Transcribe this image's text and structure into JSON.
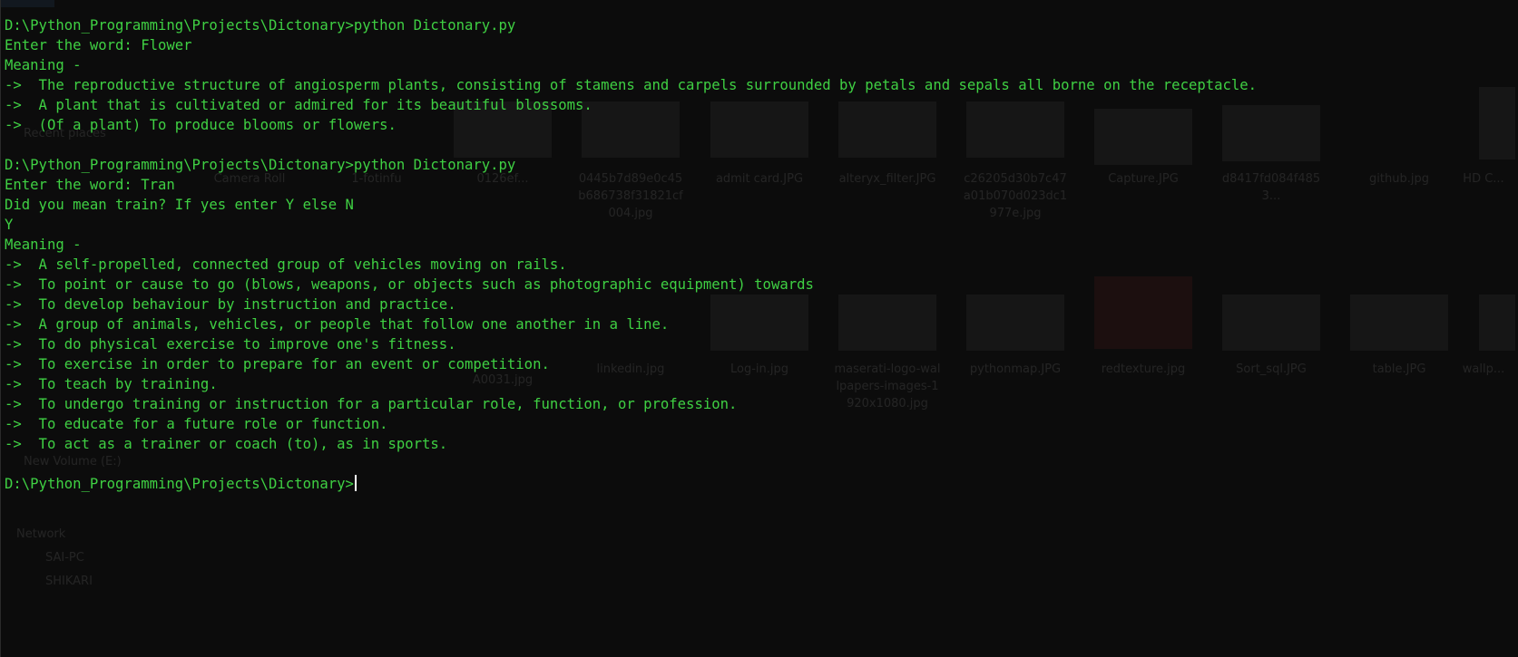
{
  "terminal": {
    "text_color": "#3fd043",
    "background": "#0c0c0c",
    "lines": [
      "D:\\Python_Programming\\Projects\\Dictonary>python Dictonary.py",
      "Enter the word: Flower",
      "Meaning -",
      "->  The reproductive structure of angiosperm plants, consisting of stamens and carpels surrounded by petals and sepals all borne on the receptacle.",
      "->  A plant that is cultivated or admired for its beautiful blossoms.",
      "->  (Of a plant) To produce blooms or flowers.",
      "",
      "D:\\Python_Programming\\Projects\\Dictonary>python Dictonary.py",
      "Enter the word: Tran",
      "Did you mean train? If yes enter Y else N",
      "Y",
      "Meaning -",
      "->  A self-propelled, connected group of vehicles moving on rails.",
      "->  To point or cause to go (blows, weapons, or objects such as photographic equipment) towards",
      "->  To develop behaviour by instruction and practice.",
      "->  A group of animals, vehicles, or people that follow one another in a line.",
      "->  To do physical exercise to improve one's fitness.",
      "->  To exercise in order to prepare for an event or competition.",
      "->  To teach by training.",
      "->  To undergo training or instruction for a particular role, function, or profession.",
      "->  To educate for a future role or function.",
      "->  To act as a trainer or coach (to), as in sports.",
      ""
    ],
    "prompt": "D:\\Python_Programming\\Projects\\Dictonary>"
  },
  "background_explorer": {
    "nav_items": [
      "Recent places",
      "New Volume (E:)",
      "Network",
      "SAI-PC",
      "SHIKARI"
    ],
    "thumbnails_row1": [
      {
        "caption": "Camera Roll"
      },
      {
        "caption": "1-fotinfu"
      },
      {
        "caption": "0126ef..."
      },
      {
        "caption": "0445b7d89e0c45b686738f31821cf004.jpg"
      },
      {
        "caption": "admit card.JPG"
      },
      {
        "caption": "alteryx_filter.JPG"
      },
      {
        "caption": "c26205d30b7c47a01b070d023dc1977e.jpg"
      },
      {
        "caption": "Capture.JPG"
      },
      {
        "caption": "d8417fd084f4853..."
      },
      {
        "caption": "github.jpg"
      },
      {
        "caption": "HD C..."
      }
    ],
    "thumbnails_row2": [
      {
        "caption": "A0031.jpg"
      },
      {
        "caption": "linkedin.jpg"
      },
      {
        "caption": "Log-in.jpg"
      },
      {
        "caption": "maserati-logo-wallpapers-images-1920x1080.jpg"
      },
      {
        "caption": "pythonmap.JPG"
      },
      {
        "caption": "redtexture.jpg"
      },
      {
        "caption": "Sort_sql.JPG"
      },
      {
        "caption": "table.JPG"
      },
      {
        "caption": "wallp..."
      }
    ]
  }
}
